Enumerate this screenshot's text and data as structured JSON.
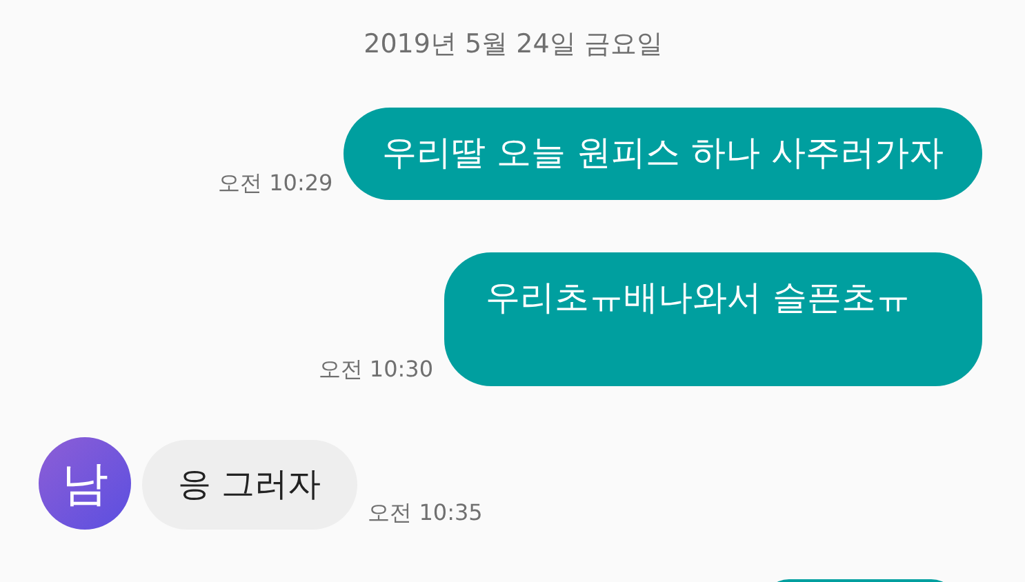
{
  "date_divider": "2019년 5월 24일 금요일",
  "messages": [
    {
      "kind": "sent",
      "text": "우리딸 오늘 원피스 하나 사주러가자",
      "time": "오전 10:29"
    },
    {
      "kind": "sent_tall",
      "text": "우리초ㅠ배나와서 슬픈초ㅠ",
      "time": "오전 10:30"
    },
    {
      "kind": "received",
      "avatar": "남",
      "text": "응 그러자",
      "time": "오전 10:35"
    },
    {
      "kind": "sent_cut"
    }
  ]
}
